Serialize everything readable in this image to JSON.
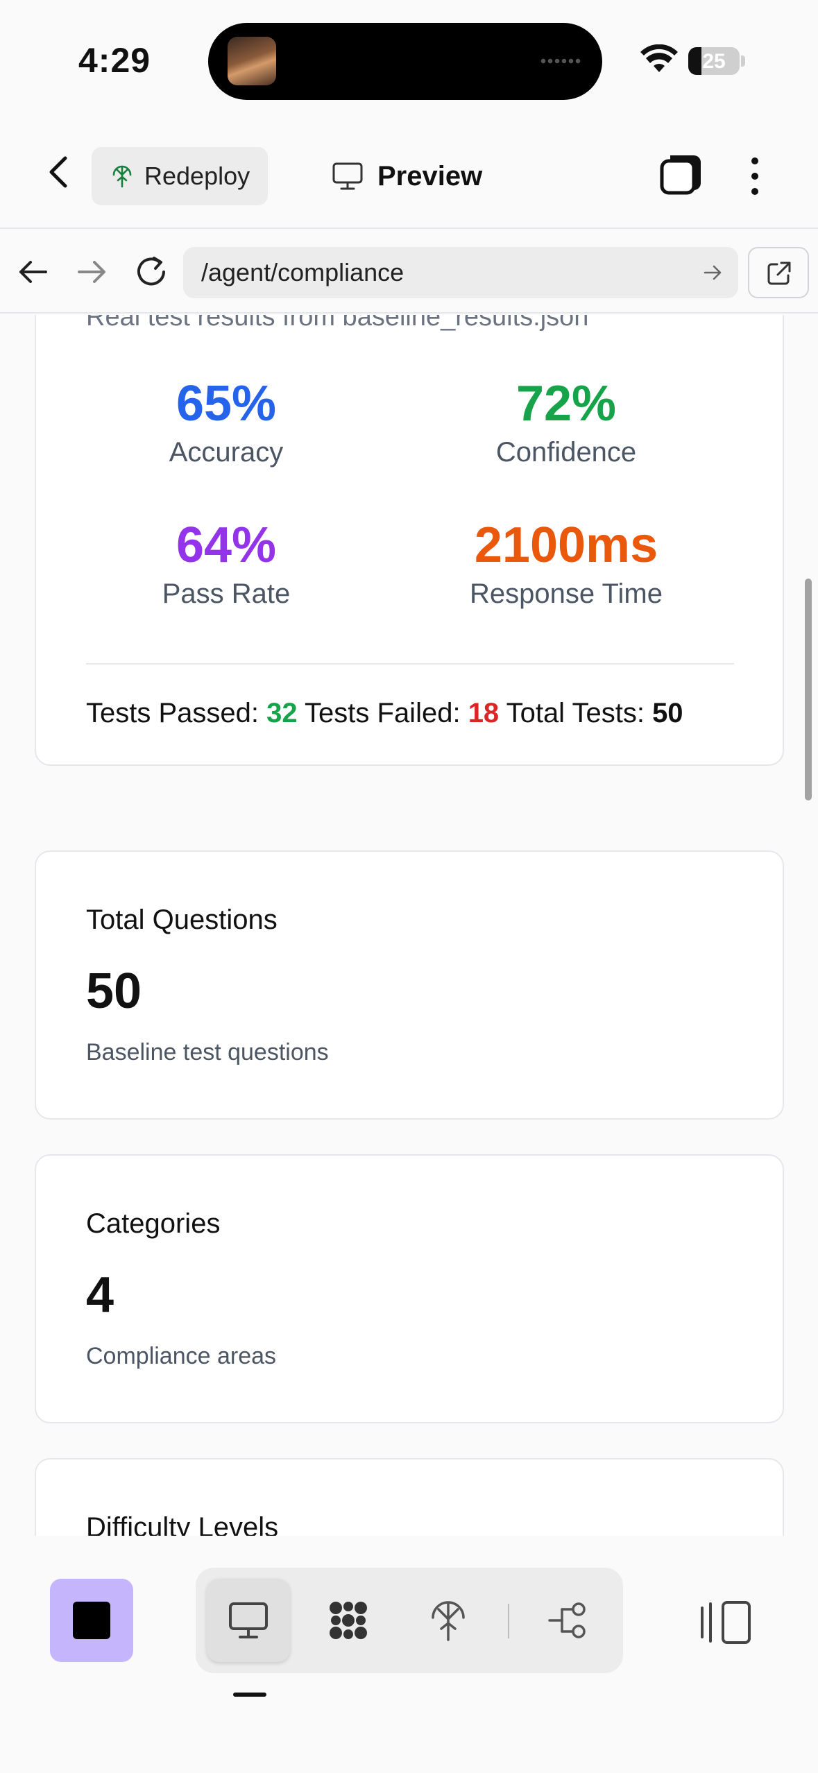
{
  "status_bar": {
    "time": "4:29",
    "battery_level": "25",
    "battery_fraction": 0.25
  },
  "header": {
    "redeploy_label": "Redeploy",
    "preview_label": "Preview"
  },
  "browser": {
    "url": "/agent/compliance"
  },
  "results": {
    "subtitle": "Real test results from baseline_results.json",
    "metrics": [
      {
        "value": "65%",
        "label": "Accuracy",
        "color": "#2563eb"
      },
      {
        "value": "72%",
        "label": "Confidence",
        "color": "#16a34a"
      },
      {
        "value": "64%",
        "label": "Pass Rate",
        "color": "#9333ea"
      },
      {
        "value": "2100ms",
        "label": "Response Time",
        "color": "#ea580c"
      }
    ],
    "tests_passed_label": "Tests Passed:",
    "tests_passed": "32",
    "tests_failed_label": "Tests Failed:",
    "tests_failed": "18",
    "total_tests_label": "Total Tests:",
    "total_tests": "50"
  },
  "stats": {
    "questions": {
      "title": "Total Questions",
      "value": "50",
      "sub": "Baseline test questions"
    },
    "categories": {
      "title": "Categories",
      "value": "4",
      "sub": "Compliance areas"
    },
    "difficulty": {
      "title": "Difficulty Levels"
    }
  },
  "icons": {
    "back": "chevron-left-icon",
    "redeploy": "antenna-icon",
    "preview": "monitor-icon",
    "tabs": "tabs-icon",
    "more": "more-vertical-icon",
    "nav_back": "arrow-left-icon",
    "nav_forward": "arrow-right-icon",
    "reload": "reload-icon",
    "open_external": "external-link-icon",
    "stop": "stop-icon",
    "toolbar": [
      "monitor-icon",
      "grid-icon",
      "antenna-icon",
      "share-icon"
    ],
    "panel": "panel-icon"
  },
  "colors": {
    "accent_purple": "#c4b5fd",
    "pass_green": "#16a34a",
    "fail_red": "#dc2626"
  }
}
